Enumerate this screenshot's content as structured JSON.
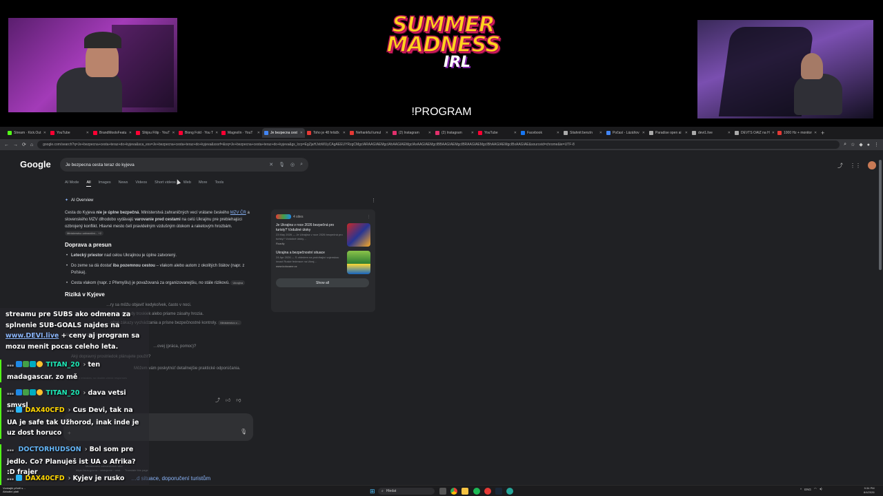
{
  "overlay": {
    "logo": {
      "line1": "SUMMER",
      "line2": "MADNESS",
      "line3": "IRL"
    },
    "program_label": "!PROGRAM"
  },
  "browser": {
    "tabs": [
      {
        "label": "Stream · Kick.Out",
        "color": "#53fc18"
      },
      {
        "label": "YouTube",
        "color": "#ff0033"
      },
      {
        "label": "BrandMoolsFeatu",
        "color": "#ff0033"
      },
      {
        "label": "Shijou Filip · YouT",
        "color": "#ff0033"
      },
      {
        "label": "Biong Fold · You T",
        "color": "#ff0033"
      },
      {
        "label": "Magnolín · YouT",
        "color": "#ff0033"
      },
      {
        "label": "Je bezpecna cest",
        "color": "#4285f4"
      },
      {
        "label": "Toho je 48 hrláčk",
        "color": "#e53935"
      },
      {
        "label": "Nefrankful lumul",
        "color": "#e53935"
      },
      {
        "label": "(2) Instagram",
        "color": "#e1306c"
      },
      {
        "label": "(2) Instagram",
        "color": "#e1306c"
      },
      {
        "label": "YouTube",
        "color": "#ff0033"
      },
      {
        "label": "Facebook",
        "color": "#1877f2"
      },
      {
        "label": "Stiahnit:benzín",
        "color": "#aaaaaa"
      },
      {
        "label": "Počasí - Lázáňov",
        "color": "#4285f4"
      },
      {
        "label": "Paradise open ai",
        "color": "#aaaaaa"
      },
      {
        "label": "devi1.live",
        "color": "#aaaaaa"
      },
      {
        "label": "DEVTS OAIZ na H",
        "color": "#aaaaaa"
      },
      {
        "label": "1000 Hz + monitor",
        "color": "#e53935"
      }
    ],
    "active_tab_index": 6,
    "url": "google.com/search?q=Je+bezpecna+cesta+teraz+do+kyjeva&sca_esv=Je+bezpecna+cesta+teraz+do+kyjeva&sxsrf=&oq=Je+bezpecna+cesta+teraz+do+kyjeva&gs_lcrp=EgZjaHJvbWUyCAgAEEUYRzgCMgcIARAAGIAEMgcIAhAAGIAEMgcIAxAAGIAEMgcIBBAAGIAEMgcIBRAAGIAEMgcIBhAAGIAEMgcIBxAAGIAE&sourceid=chrome&ie=UTF-8"
  },
  "google": {
    "logo": "Google",
    "query": "Je bezpecna cesta teraz do kyjeva",
    "filters": [
      "AI Mode",
      "All",
      "Images",
      "News",
      "Videos",
      "Short videos",
      "Web",
      "More",
      "Tools"
    ],
    "active_filter": "All",
    "ai_overview_label": "AI Overview",
    "ai": {
      "intro_p1": "Cesta do Kyjeva ",
      "intro_b1": "nie je úplne bezpečná",
      "intro_p2": ". Ministerstvá zahraničných vecí vrátane českého ",
      "intro_link": "MZV ČR",
      "intro_p3": " a slovenského MZV dlhodobo vydávajú ",
      "intro_b2": "varovanie pred cestami",
      "intro_p4": " na celú Ukrajinu pre prebiehajúci ozbrojený konflikt. Hlavné mesto čelí pravidelným vzdušným útokom a raketovým hrozbám.",
      "intro_chip": "Ministerstvo zahraniční... +2",
      "h_transport": "Doprava a presun",
      "b1_bold": "Letecký priestor",
      "b1_rest": " nad celou Ukrajinou je úplne zatvorený.",
      "b2_p1": "Do zeme sa dá dostať ",
      "b2_bold": "iba pozemnou cestou",
      "b2_rest": " – vlakom alebo autom z okolitých štátov (napr. z Poľska).",
      "b3_text": "Cesta vlakom (napr. z Přemyšlu) je považovaná za organizovanejšiu, no stále rizikovú.",
      "b3_chip": "Ukrajina",
      "h_risks": "Riziká v Kyjeve",
      "r1": "…ry sa môžu objaviť kedykoľvek, často v noci.",
      "r2": "…zana, dopady troskiek alebo priame zásahy hrozia.",
      "r3": "…očné zákazy vychádzania a prísne bezpečnostné kontroly.",
      "r3_chip": "Ministerstvo z...",
      "follow_intro": "Ak cestu zvažujete, povedzte mi:",
      "q1": "…ovej (práca, pomoc)?",
      "q2": "Aký dopravný prostriedok plánujete použiť?",
      "outro": "Môžem vám poskytnúť detailnejšie praktické odporúčania.",
      "faded_line": "Ai can make mistakes, so double-check responses"
    },
    "side_card": {
      "sites_label": "4 sites",
      "items": [
        {
          "title": "Je Ukrajina v roce 2026 bezpečná pro turisty? Vzdušné útoky",
          "date": "23 May 2026 — Je Ukrajina v roce 2026 bezpečná pro turisty? Vzdušné útoky…",
          "source": "Roadly"
        },
        {
          "title": "Ukrajina a bezpečnostní situace",
          "date": "24 Apr 2026 — S ohledem na probíhající vojenskou invazi Ruské federace na Ukraj…",
          "source": "www.kolocane.cz"
        }
      ],
      "show_all": "Show all"
    },
    "result": {
      "source_name": "Ministerstvo zahraničních věcí",
      "source_url": "https://mzv.gov.cz › cestujeme › cest... · Translate this page",
      "title": "…d situace, doporučení turistům"
    }
  },
  "chat": {
    "messages": [
      {
        "user": "",
        "text_a": "streamu pre SUBS ako odmena za splnenie SUB-GOALS najdes na ",
        "link": "www.DEVI.live",
        "text_b": " + ceny aj program sa mozu menit pocas celeho leta.",
        "color": "#ffffff"
      },
      {
        "user": "TITAN_20",
        "text": "ten madagascar. zo mě",
        "color": "#1de9b6"
      },
      {
        "user": "TITAN_20",
        "text": "dava vetsi smysl",
        "color": "#1de9b6"
      },
      {
        "user": "DAX40CFD",
        "text": "Cus Devi, tak na UA je safe tak Užhorod, inak inde je uz dost horuco",
        "color": "#ffd600"
      },
      {
        "user": "DOCTORHUDSON",
        "text": "Bol som pre jedlo. Co? Planuješ ist UA o Afrika? :D frajer",
        "color": "#64b5f6"
      },
      {
        "user": "DAX40CFD",
        "text": "Kyjev je rusko ruleta",
        "color": "#ffd600"
      }
    ]
  },
  "taskbar": {
    "left_line1": "Vonkajší přívěl s…",
    "left_line2": "Aktuální platí",
    "search_label": "Hledat",
    "lang": "ENG",
    "time": "9:34 PM",
    "date": "8/4/2026"
  }
}
